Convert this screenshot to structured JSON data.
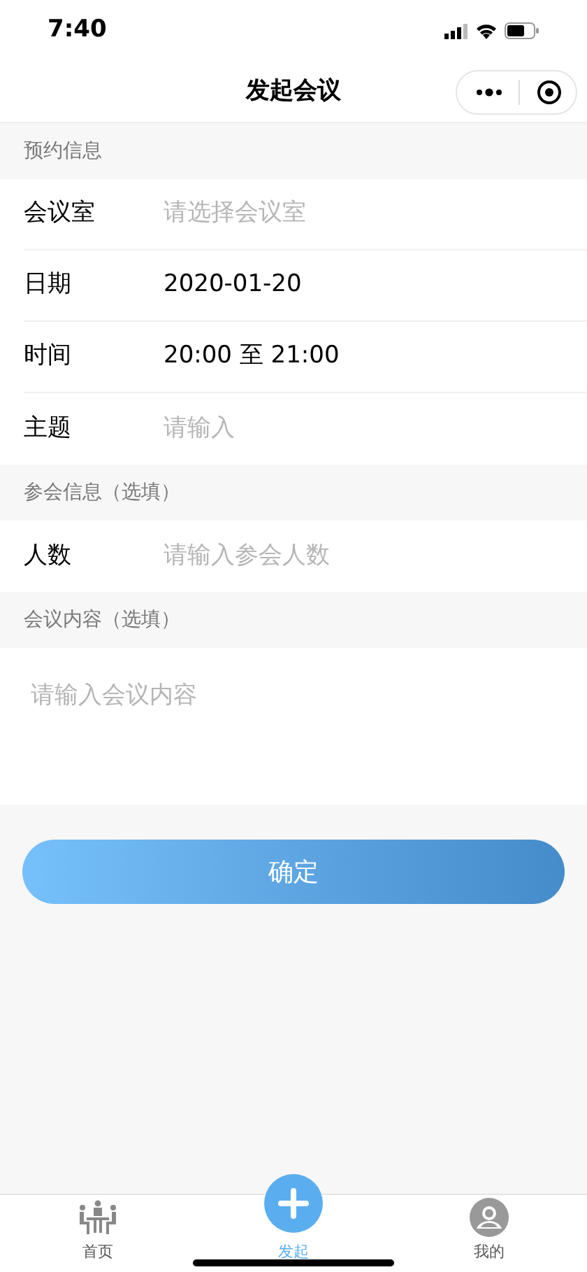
{
  "status_bar": {
    "time": "7:40"
  },
  "nav": {
    "title": "发起会议"
  },
  "sections": [
    {
      "header": "预约信息",
      "rows": [
        {
          "label": "会议室",
          "placeholder": "请选择会议室"
        },
        {
          "label": "日期",
          "value": "2020-01-20"
        },
        {
          "label": "时间",
          "value": "20:00 至 21:00"
        },
        {
          "label": "主题",
          "placeholder": "请输入"
        }
      ]
    },
    {
      "header": "参会信息（选填）",
      "rows": [
        {
          "label": "人数",
          "placeholder": "请输入参会人数"
        }
      ]
    },
    {
      "header": "会议内容（选填）",
      "textarea": {
        "placeholder": "请输入会议内容"
      }
    }
  ],
  "submit": "确定",
  "tabs": [
    {
      "kind": "home",
      "label": "首页",
      "selected": false
    },
    {
      "kind": "create",
      "label": "发起",
      "selected": true
    },
    {
      "kind": "me",
      "label": "我的",
      "selected": false
    }
  ]
}
